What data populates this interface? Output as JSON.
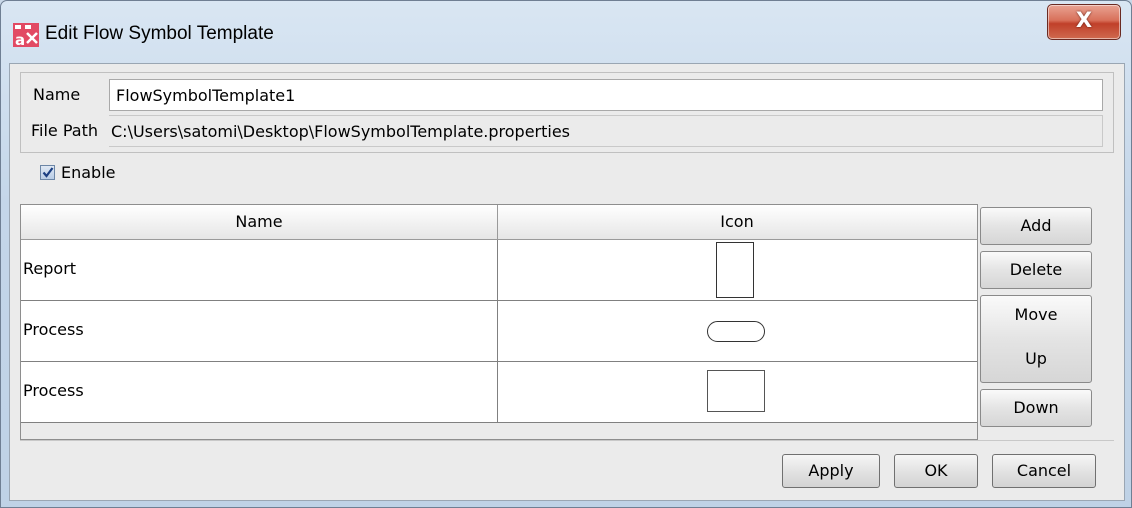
{
  "window": {
    "title": "Edit Flow Symbol Template",
    "close_label": "X"
  },
  "form": {
    "name_label": "Name",
    "name_value": "FlowSymbolTemplate1",
    "path_label": "File Path",
    "path_value": "C:\\Users\\satomi\\Desktop\\FlowSymbolTemplate.properties",
    "enable_label": "Enable",
    "enable_checked": true
  },
  "table": {
    "columns": [
      "Name",
      "Icon"
    ],
    "rows": [
      {
        "name": "Report",
        "icon": "tall-rectangle-icon"
      },
      {
        "name": "Process",
        "icon": "rounded-rectangle-icon"
      },
      {
        "name": "Process",
        "icon": "rectangle-icon"
      }
    ]
  },
  "side_buttons": {
    "add": "Add",
    "delete": "Delete",
    "move": "Move",
    "up": "Up",
    "down": "Down"
  },
  "footer": {
    "apply": "Apply",
    "ok": "OK",
    "cancel": "Cancel"
  }
}
